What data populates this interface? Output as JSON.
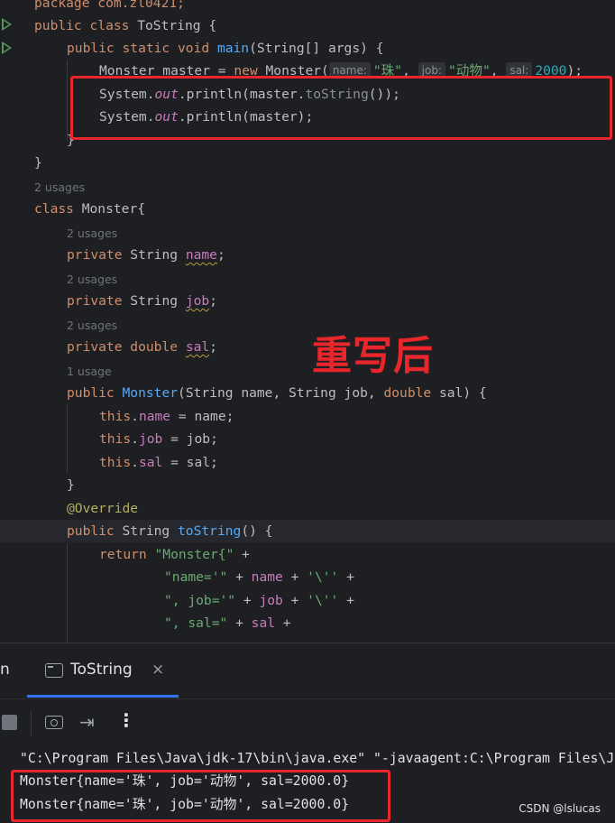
{
  "editor": {
    "package_line": "package com.zl0421;",
    "class_line_kw": "public class",
    "class_name": "ToString",
    "class_open": " {",
    "main_kw": "public static void",
    "main_fn": "main",
    "main_params": "(String[] args) {",
    "new_line_start": "Monster master = ",
    "new_kw": "new",
    "new_type": " Monster(",
    "hint_name": "name:",
    "arg_name": "\"珠\"",
    "hint_job": "job:",
    "arg_job": "\"动物\"",
    "hint_sal": "sal:",
    "arg_sal": "2000",
    "arg_end": ");",
    "println1_a": "System.",
    "println1_out": "out",
    "println1_b": ".println(master.",
    "println1_fn": "toString",
    "println1_c": "());",
    "println2_a": "System.",
    "println2_out": "out",
    "println2_b": ".println(master);",
    "close_inner": "}",
    "close_outer": "}",
    "usages_class": "2 usages",
    "monster_kw": "class",
    "monster_name": " Monster{",
    "usages_name": "2 usages",
    "name_kw": "private",
    "name_type": " String ",
    "name_field": "name",
    "name_end": ";",
    "usages_job": "2 usages",
    "job_kw": "private",
    "job_type": " String ",
    "job_field": "job",
    "job_end": ";",
    "usages_sal": "2 usages",
    "sal_kw": "private double",
    "sal_field": "sal",
    "sal_end": ";",
    "usages_ctor": "1 usage",
    "ctor_kw": "public",
    "ctor_name": "Monster",
    "ctor_a": "(String name, String job, ",
    "ctor_double": "double",
    "ctor_b": " sal) {",
    "this1_kw": "this",
    "this1_dot": ".",
    "this1_field": "name",
    "this1_rest": " = name;",
    "this2_kw": "this",
    "this2_dot": ".",
    "this2_field": "job",
    "this2_rest": " = job;",
    "this3_kw": "this",
    "this3_dot": ".",
    "this3_field": "sal",
    "this3_rest": " = sal;",
    "close_ctor": "}",
    "override": "@Override",
    "ts_kw": "public",
    "ts_type": " String ",
    "ts_fn": "toString",
    "ts_rest": "() {",
    "ret_kw": "return",
    "ret_str": " \"Monster{\"",
    "ret_plus": " +",
    "l1_str": "\"name='\"",
    "l1_plus": " + ",
    "l1_field": "name",
    "l1_plus2": " + ",
    "l1_char": "'\\''",
    "l1_end": " +",
    "l2_str": "\", job='\"",
    "l2_plus": " + ",
    "l2_field": "job",
    "l2_plus2": " + ",
    "l2_char": "'\\''",
    "l2_end": " +",
    "l3_str": "\", sal=\"",
    "l3_plus": " + ",
    "l3_field": "sal",
    "l3_end": " +"
  },
  "annotation": {
    "label": "重写后",
    "color": "#e8262b"
  },
  "tool_window": {
    "prev_tab_fragment": "n",
    "tab_label": "ToString",
    "tab_close": "×",
    "exit_icon": "⇥",
    "more_icon": "⋮",
    "console": [
      "\"C:\\Program Files\\Java\\jdk-17\\bin\\java.exe\" \"-javaagent:C:\\Program Files\\J",
      "Monster{name='珠', job='动物', sal=2000.0}",
      "Monster{name='珠', job='动物', sal=2000.0}"
    ],
    "watermark": "CSDN @lslucas"
  },
  "icons": [
    "run-icon",
    "run-icon",
    "override-icon",
    "console-tab-icon",
    "close-icon",
    "stop-icon",
    "camera-icon",
    "exit-icon",
    "more-icon"
  ],
  "colors": {
    "background": "#1e1f22",
    "keyword": "#cf8e6d",
    "function": "#56a8f5",
    "field": "#c77dbb",
    "string": "#6aab73",
    "number": "#2aacb8",
    "annotation": "#b3ae60",
    "accent": "#3574f0"
  }
}
